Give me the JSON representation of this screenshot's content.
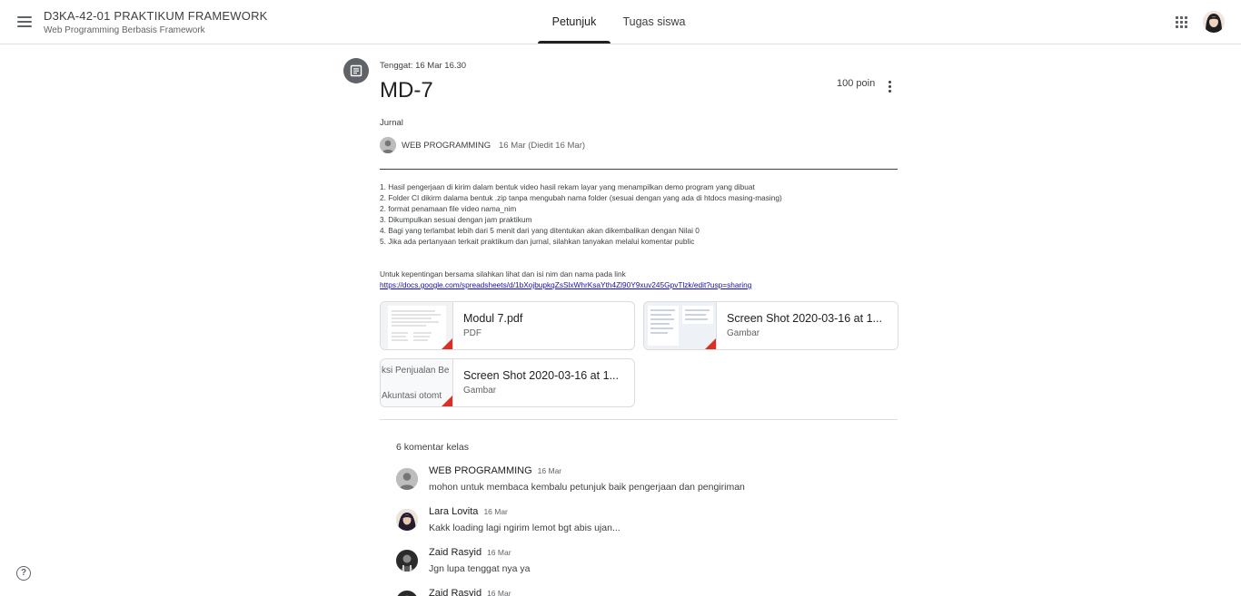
{
  "header": {
    "class_title": "D3KA-42-01 PRAKTIKUM FRAMEWORK",
    "class_subtitle": "Web Programming Berbasis Framework",
    "tabs": [
      {
        "label": "Petunjuk",
        "active": true
      },
      {
        "label": "Tugas siswa",
        "active": false
      }
    ]
  },
  "assignment": {
    "due": "Tenggat: 16 Mar 16.30",
    "title": "MD-7",
    "points": "100 poin",
    "topic": "Jurnal",
    "author": "WEB PROGRAMMING",
    "posted": "16 Mar (Diedit 16 Mar)",
    "instructions": [
      "1. Hasil pengerjaan di kirim dalam bentuk video hasil rekam layar yang menampilkan demo program yang dibuat",
      "2. Folder CI dikirm dalama bentuk .zip tanpa mengubah nama folder (sesuai dengan yang ada di htdocs masing-masing)",
      "2. format penamaan file video nama_nim",
      "3. Dikumpulkan sesuai dengan jam praktikum",
      "4. Bagi yang terlambat lebih dari 5 menit dari yang ditentukan akan dikembalikan dengan Nilai 0",
      "5. Jika ada pertanyaan terkait praktikum dan jurnal, silahkan tanyakan melalui komentar public"
    ],
    "note": "Untuk kepentingan bersama silahkan lihat dan isi nim dan nama pada link",
    "link": "https://docs.google.com/spreadsheets/d/1bXojbupkqZsSlxWhrKsaYth4Zl90Y9xuv245GpvTlzk/edit?usp=sharing"
  },
  "attachments": [
    {
      "name": "Modul 7.pdf",
      "type": "PDF"
    },
    {
      "name": "Screen Shot 2020-03-16 at 1...",
      "type": "Gambar"
    },
    {
      "name": "Screen Shot 2020-03-16 at 1...",
      "type": "Gambar",
      "thumb_lines": [
        "ksi Penjualan Be",
        "Akuntasi otomt"
      ]
    }
  ],
  "comments": {
    "header": "6 komentar kelas",
    "items": [
      {
        "author": "WEB PROGRAMMING",
        "date": "16 Mar",
        "text": "mohon untuk membaca kembalu petunjuk baik pengerjaan dan pengiriman"
      },
      {
        "author": "Lara Lovita",
        "date": "16 Mar",
        "text": "Kakk loading lagi ngirim lemot bgt abis ujan..."
      },
      {
        "author": "Zaid Rasyid",
        "date": "16 Mar",
        "text": "Jgn lupa tenggat nya ya"
      },
      {
        "author": "Zaid Rasyid",
        "date": "16 Mar",
        "text": ""
      }
    ]
  },
  "icons": {
    "menu": "hamburger-menu-icon",
    "apps": "google-apps-grid-icon",
    "assignment": "assignment-icon",
    "more": "more-vert-icon",
    "help": "help-circle-icon"
  },
  "colors": {
    "text_primary": "#202124",
    "text_secondary": "#5f6368",
    "link": "#1a0dab",
    "pdf_fold": "#d93025",
    "border": "#dadce0"
  }
}
